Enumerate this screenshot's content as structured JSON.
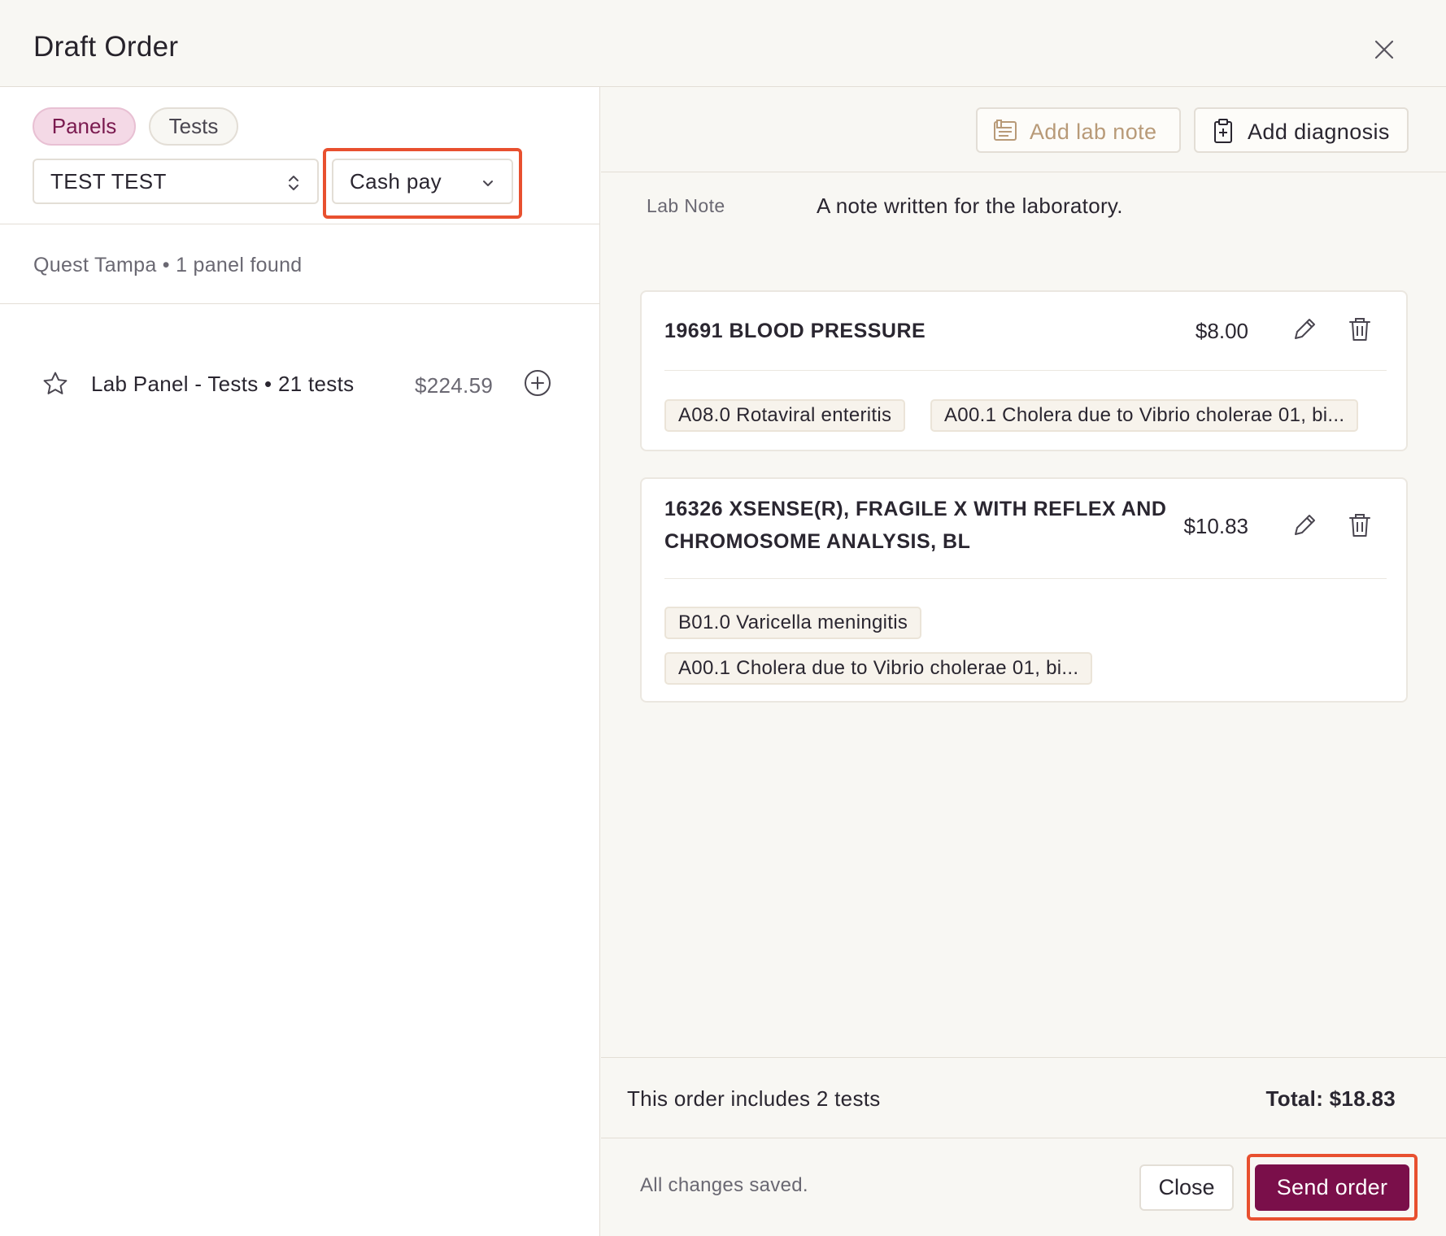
{
  "header": {
    "title": "Draft Order",
    "close_icon": "close-icon"
  },
  "left": {
    "tabs": [
      {
        "label": "Panels",
        "active": true
      },
      {
        "label": "Tests",
        "active": false
      }
    ],
    "patient_select": {
      "value": "TEST TEST"
    },
    "billing_select": {
      "value": "Cash pay"
    },
    "info": "Quest Tampa • 1 panel found",
    "panels": [
      {
        "name": "Lab Panel - Tests • 21 tests",
        "price": "$224.59"
      }
    ]
  },
  "right": {
    "toolbar": {
      "add_lab_note": "Add lab note",
      "add_diagnosis": "Add diagnosis"
    },
    "lab_note": {
      "label": "Lab Note",
      "text": "A note written for the laboratory."
    },
    "tests": [
      {
        "name": "19691 BLOOD PRESSURE",
        "price": "$8.00",
        "diagnoses": [
          "A08.0 Rotaviral enteritis",
          "A00.1 Cholera due to Vibrio cholerae 01, bi..."
        ]
      },
      {
        "name_line1": "16326 XSENSE(R), FRAGILE X WITH REFLEX AND",
        "name_line2": "CHROMOSOME ANALYSIS, BL",
        "price": "$10.83",
        "diagnoses": [
          "B01.0 Varicella meningitis",
          "A00.1 Cholera due to Vibrio cholerae 01, bi..."
        ]
      }
    ],
    "summary": {
      "count_text": "This order includes 2 tests",
      "total_text": "Total: $18.83"
    },
    "footer": {
      "saved_text": "All changes saved.",
      "close_label": "Close",
      "send_label": "Send order"
    }
  },
  "colors": {
    "accent": "#7a0f4a",
    "highlight": "#e8502f",
    "active_tab_bg": "#f4d9e6"
  }
}
